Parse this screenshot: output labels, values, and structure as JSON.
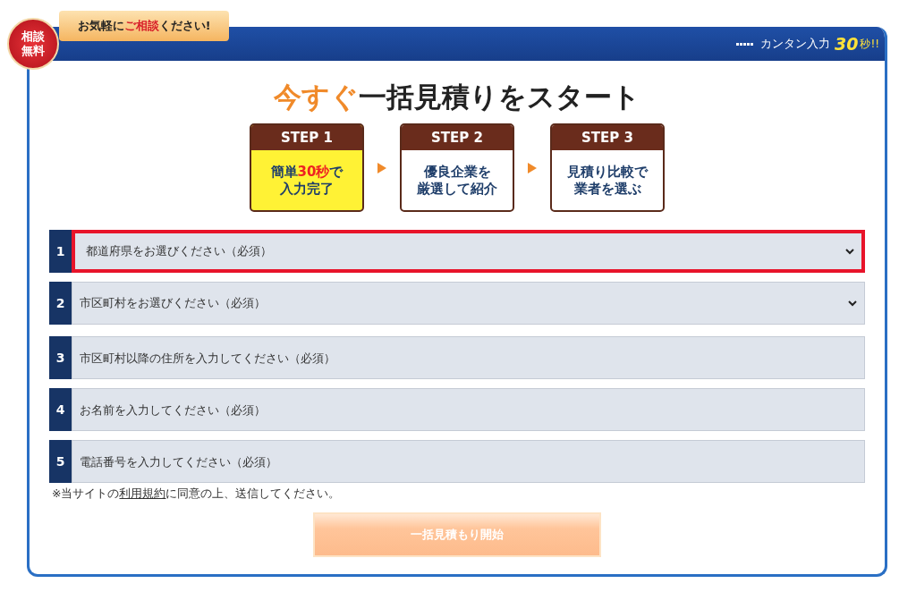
{
  "badge": {
    "lines": [
      "相談",
      "無料"
    ]
  },
  "ribbon": {
    "text": "お気軽に**ご相談**ください!"
  },
  "header": {
    "label": "カンタン入力",
    "emphasis": "30",
    "suffix": "秒!!"
  },
  "title": {
    "accent": "今すぐ",
    "rest": "一括見積りをスタート"
  },
  "steps": [
    {
      "label": "STEP 1",
      "lines": [
        "簡単**30秒**で",
        "入力完了"
      ],
      "selected": true
    },
    {
      "label": "STEP 2",
      "lines": [
        "優良企業を",
        "厳選して紹介"
      ],
      "selected": false
    },
    {
      "label": "STEP 3",
      "lines": [
        "見積り比較で",
        "業者を選ぶ"
      ],
      "selected": false
    }
  ],
  "fields": [
    {
      "number": "1",
      "kind": "select",
      "placeholder": "都道府県をお選びください（必須）",
      "selected": true
    },
    {
      "number": "2",
      "kind": "select",
      "placeholder": "市区町村をお選びください（必須）",
      "selected": false
    },
    {
      "number": "3",
      "kind": "input",
      "placeholder": "市区町村以降の住所を入力してください（必須）",
      "selected": false
    },
    {
      "number": "4",
      "kind": "input",
      "placeholder": "お名前を入力してください（必須）",
      "selected": false
    },
    {
      "number": "5",
      "kind": "input",
      "placeholder": "電話番号を入力してください（必須）",
      "selected": false
    }
  ],
  "note": {
    "before": "※当サイトの",
    "link": "利用規約",
    "after": "に同意の上、送信してください。"
  },
  "submit": {
    "label": "一括見積もり開始",
    "disabled": true
  }
}
